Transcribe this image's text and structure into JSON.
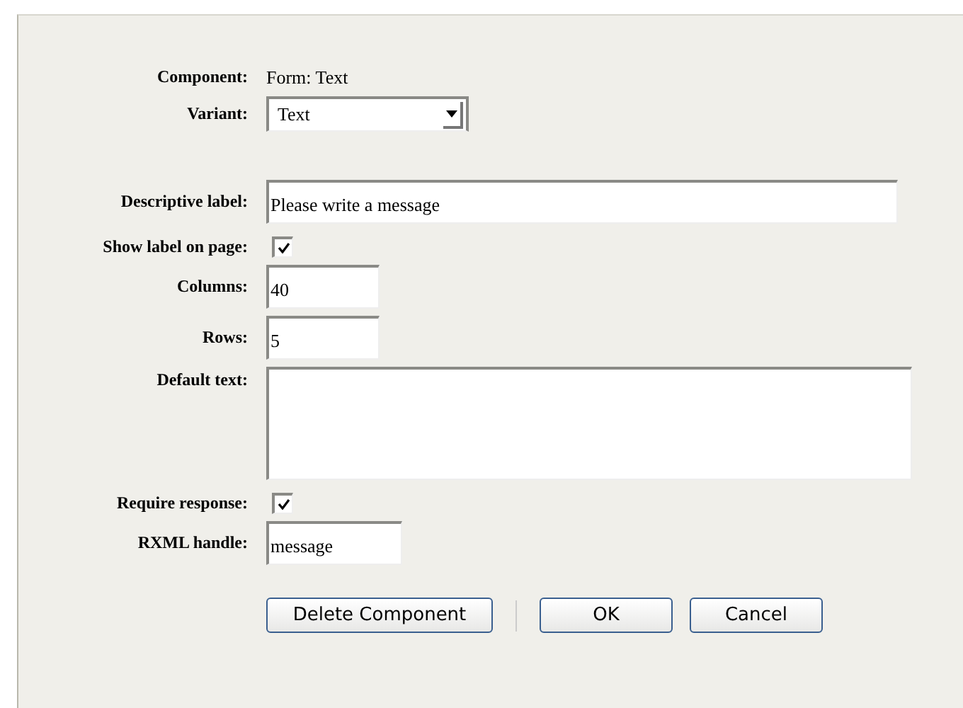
{
  "fields": [
    {
      "kind": "static",
      "label": "Component:",
      "value": "Form: Text"
    },
    {
      "kind": "select",
      "label": "Variant:",
      "value": "Text"
    },
    {
      "kind": "spacer"
    },
    {
      "kind": "text",
      "label": "Descriptive label:",
      "value": "Please write a message"
    },
    {
      "kind": "checkbox",
      "label": "Show label on page:",
      "checked": true
    },
    {
      "kind": "number",
      "label": "Columns:",
      "value": "40"
    },
    {
      "kind": "number",
      "label": "Rows:",
      "value": "5"
    },
    {
      "kind": "textarea",
      "label": "Default text:"
    },
    {
      "kind": "checkbox",
      "label": "Require response:",
      "checked": true
    },
    {
      "kind": "short_text",
      "label": "RXML handle:",
      "value": "message"
    }
  ],
  "buttons": [
    "Delete Component",
    "OK",
    "Cancel"
  ]
}
